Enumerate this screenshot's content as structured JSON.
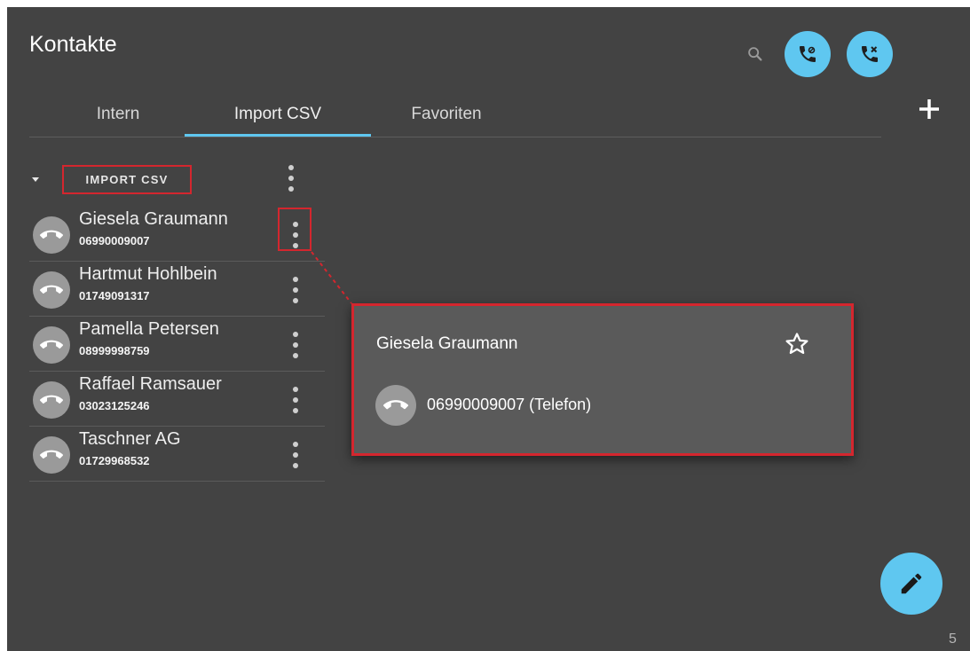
{
  "header": {
    "title": "Kontakte",
    "search_icon": "search-icon",
    "call_forward_icon": "phone-settings-icon",
    "call_block_icon": "phone-missed-icon",
    "add_icon": "plus-icon"
  },
  "tabs": [
    {
      "label": "Intern",
      "active": false
    },
    {
      "label": "Import CSV",
      "active": true
    },
    {
      "label": "Favoriten",
      "active": false
    }
  ],
  "group": {
    "label": "IMPORT CSV",
    "expanded": true
  },
  "contacts": [
    {
      "name": "Giesela Graumann",
      "number": "06990009007"
    },
    {
      "name": "Hartmut Hohlbein",
      "number": "01749091317"
    },
    {
      "name": "Pamella Petersen",
      "number": "08999998759"
    },
    {
      "name": "Raffael Ramsauer",
      "number": "03023125246"
    },
    {
      "name": "Taschner AG",
      "number": "01729968532"
    }
  ],
  "popup": {
    "name": "Giesela Graumann",
    "phone": "06990009007 (Telefon)",
    "favorite_icon": "star-outline-icon"
  },
  "fab": {
    "icon": "pencil-icon"
  },
  "page_number": "5",
  "colors": {
    "background": "#434343",
    "accent": "#5fc7f0",
    "highlight": "#d4262e",
    "popup_bg": "#5a5a5a",
    "avatar": "#9a9a9a"
  }
}
